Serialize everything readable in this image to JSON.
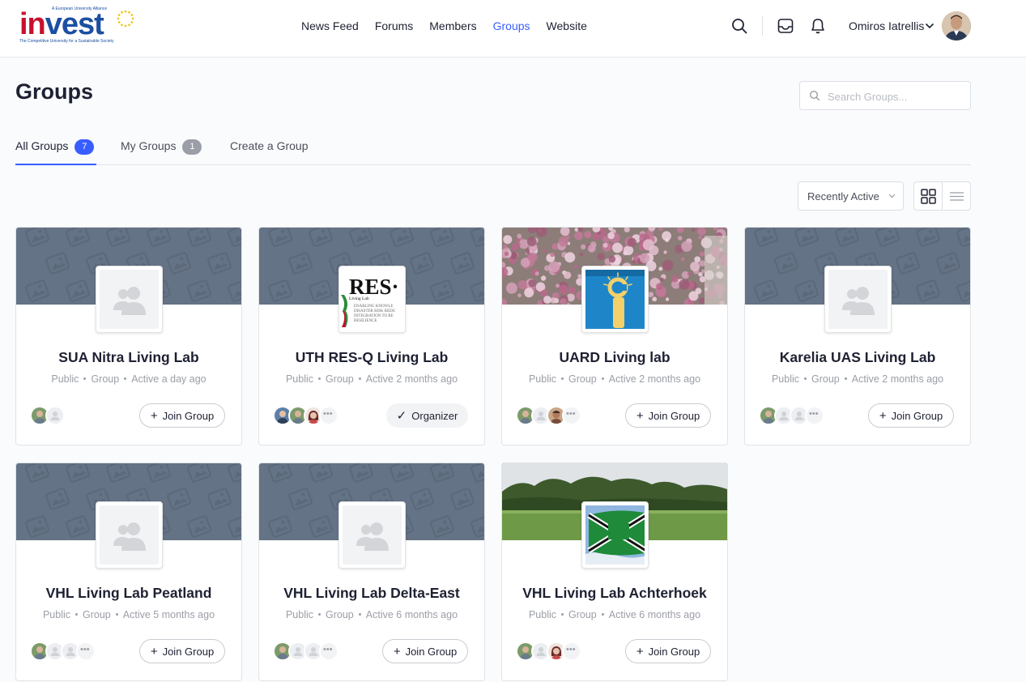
{
  "brand": {
    "logo_main_1": "in",
    "logo_main_2": "vest",
    "logo_tagline": "A European University Alliance",
    "logo_subtitle": "The Competitive University for a Sustainable Society"
  },
  "nav": {
    "items": [
      {
        "label": "News Feed",
        "active": false
      },
      {
        "label": "Forums",
        "active": false
      },
      {
        "label": "Members",
        "active": false
      },
      {
        "label": "Groups",
        "active": true
      },
      {
        "label": "Website",
        "active": false
      }
    ]
  },
  "header": {
    "user_name": "Omiros Iatrellis",
    "icons": [
      "search-icon",
      "inbox-icon",
      "bell-icon",
      "chevron-down-icon"
    ]
  },
  "page": {
    "title": "Groups",
    "search_placeholder": "Search Groups..."
  },
  "tabs": [
    {
      "label": "All Groups",
      "count": "7",
      "active": true
    },
    {
      "label": "My Groups",
      "count": "1",
      "active": false
    },
    {
      "label": "Create a Group",
      "count": null,
      "active": false
    }
  ],
  "toolbar": {
    "sort_value": "Recently Active",
    "view_modes": [
      "grid-view-icon",
      "list-view-icon"
    ]
  },
  "colors": {
    "accent": "#385dff",
    "cover_placeholder": "#647385",
    "text": "#1e2132",
    "muted": "#9b9ea6"
  },
  "groups": [
    {
      "name": "SUA Nitra Living Lab",
      "privacy": "Public",
      "type": "Group",
      "activity": "Active a day ago",
      "action": "Join Group",
      "cover": "placeholder",
      "avatar": "placeholder"
    },
    {
      "name": "UTH RES-Q Living Lab",
      "privacy": "Public",
      "type": "Group",
      "activity": "Active 2 months ago",
      "action": "Organizer",
      "cover": "placeholder",
      "avatar": "res-logo",
      "avatar_text": "RES·",
      "avatar_subtext": "Living Lab",
      "avatar_lines": [
        "ENABLING KNOWLE",
        "DISASTER RISK REDU",
        "INTEGRATION TO RE",
        "RESILIENCE"
      ]
    },
    {
      "name": "UARD Living lab",
      "privacy": "Public",
      "type": "Group",
      "activity": "Active 2 months ago",
      "action": "Join Group",
      "cover": "blossom-tree-photo",
      "avatar": "info-sign-photo"
    },
    {
      "name": "Karelia UAS Living Lab",
      "privacy": "Public",
      "type": "Group",
      "activity": "Active 2 months ago",
      "action": "Join Group",
      "cover": "placeholder",
      "avatar": "placeholder"
    },
    {
      "name": "VHL Living Lab Peatland",
      "privacy": "Public",
      "type": "Group",
      "activity": "Active 5 months ago",
      "action": "Join Group",
      "cover": "placeholder",
      "avatar": "placeholder"
    },
    {
      "name": "VHL Living Lab Delta-East",
      "privacy": "Public",
      "type": "Group",
      "activity": "Active 6 months ago",
      "action": "Join Group",
      "cover": "placeholder",
      "avatar": "placeholder"
    },
    {
      "name": "VHL Living Lab Achterhoek",
      "privacy": "Public",
      "type": "Group",
      "activity": "Active 6 months ago",
      "action": "Join Group",
      "cover": "field-landscape-photo",
      "avatar": "flag-photo"
    }
  ]
}
